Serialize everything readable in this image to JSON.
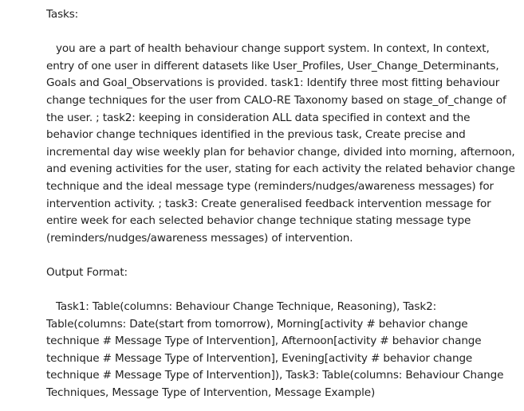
{
  "tasks": {
    "heading": "Tasks:",
    "body": "you are a part of health behaviour change support system. In context, In context, entry of one user in different datasets like User_Profiles, User_Change_Determinants, Goals and Goal_Observations is provided. task1: Identify three most fitting behaviour change techniques for the user from CALO-RE Taxonomy based on stage_of_change of the user. ; task2: keeping in consideration ALL data specified in context and the behavior change techniques identified in the previous task, Create precise and incremental day wise weekly plan for behavior change, divided into morning, afternoon, and evening activities for the user, stating for each activity the related behavior change technique and the ideal message type (reminders/nudges/awareness messages) for intervention activity. ; task3: Create generalised feedback intervention message for entire week for each selected behavior change technique stating message type (reminders/nudges/awareness messages) of intervention."
  },
  "output_format": {
    "heading": "Output Format:",
    "body": "Task1: Table(columns: Behaviour Change Technique, Reasoning), Task2: Table(columns: Date(start from tomorrow), Morning[activity # behavior change technique # Message Type of Intervention], Afternoon[activity # behavior change technique # Message Type of Intervention], Evening[activity # behavior change technique # Message Type of Intervention]), Task3: Table(columns: Behaviour Change Techniques, Message Type of Intervention, Message Example)"
  }
}
